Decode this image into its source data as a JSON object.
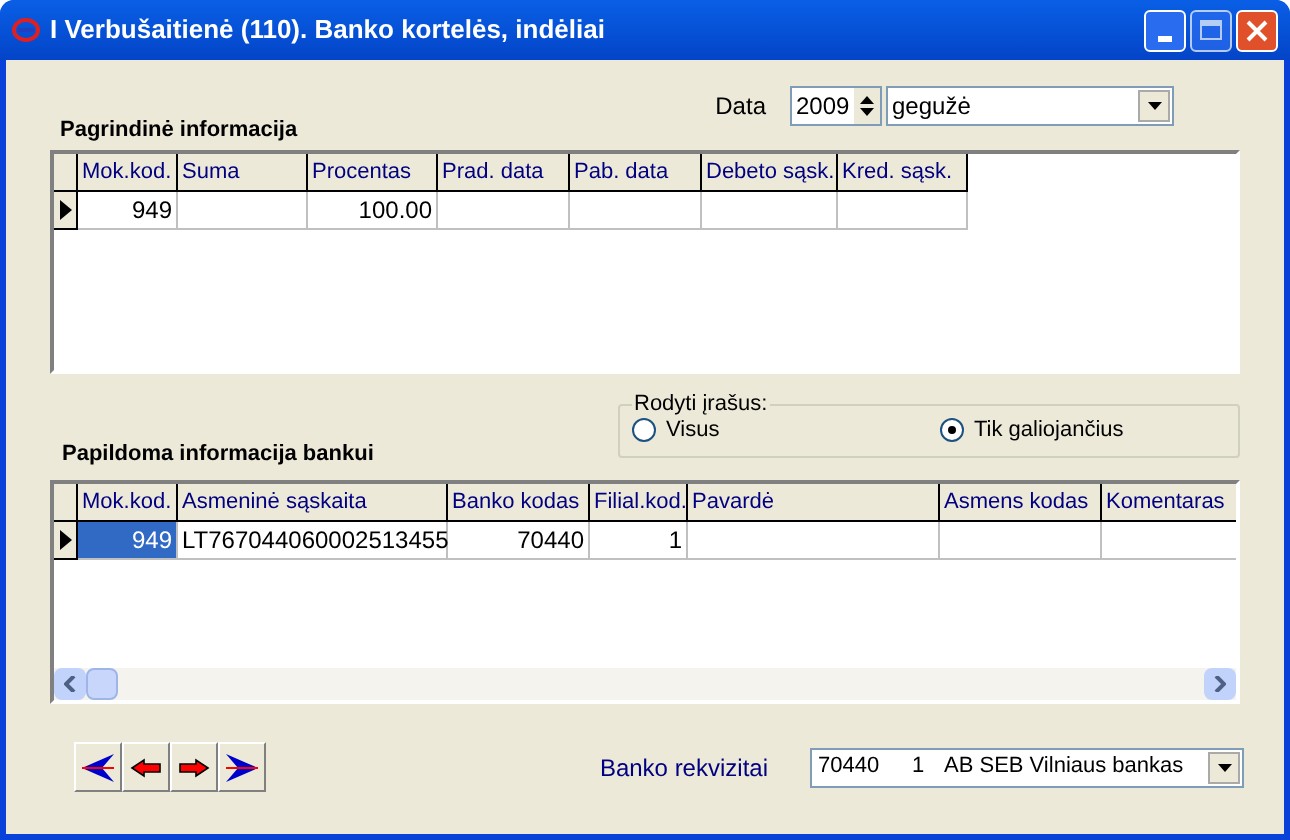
{
  "window": {
    "title": "I Verbušaitienė (110). Banko kortelės, indėliai"
  },
  "date": {
    "label": "Data",
    "year": "2009",
    "month": "gegužė"
  },
  "main_section": {
    "heading": "Pagrindinė informacija",
    "columns": [
      {
        "label": "Mok.kod.",
        "kind": "number"
      },
      {
        "label": "Suma",
        "kind": "number"
      },
      {
        "label": "Procentas",
        "kind": "number"
      },
      {
        "label": "Prad. data",
        "kind": "text"
      },
      {
        "label": "Pab. data",
        "kind": "text"
      },
      {
        "label": "Debeto sąsk.",
        "kind": "text"
      },
      {
        "label": "Kred. sąsk.",
        "kind": "text"
      }
    ],
    "rows": [
      {
        "current": true,
        "cells": [
          {
            "text": "949",
            "selected": false
          },
          {
            "text": "",
            "selected": false
          },
          {
            "text": "100.00",
            "selected": false
          },
          {
            "text": "",
            "selected": false
          },
          {
            "text": "",
            "selected": false
          },
          {
            "text": "",
            "selected": false
          },
          {
            "text": "",
            "selected": false
          }
        ]
      }
    ]
  },
  "filter": {
    "title": "Rodyti įrašus:",
    "options": [
      {
        "label": "Visus",
        "selected": false
      },
      {
        "label": "Tik galiojančius",
        "selected": true
      }
    ]
  },
  "bank_section": {
    "heading": "Papildoma informacija bankui",
    "columns": [
      {
        "label": "Mok.kod.",
        "kind": "number"
      },
      {
        "label": "Asmeninė sąskaita",
        "kind": "text"
      },
      {
        "label": "Banko kodas",
        "kind": "number"
      },
      {
        "label": "Filial.kod.",
        "kind": "number"
      },
      {
        "label": "Pavardė",
        "kind": "text"
      },
      {
        "label": "Asmens kodas",
        "kind": "text"
      },
      {
        "label": "Komentaras",
        "kind": "text"
      }
    ],
    "rows": [
      {
        "current": true,
        "cells": [
          {
            "text": "949",
            "selected": true
          },
          {
            "text": "LT767044060002513455",
            "selected": false
          },
          {
            "text": "70440",
            "selected": false
          },
          {
            "text": "1",
            "selected": false
          },
          {
            "text": "",
            "selected": false
          },
          {
            "text": "",
            "selected": false
          },
          {
            "text": "",
            "selected": false
          }
        ]
      }
    ]
  },
  "navigation": [
    {
      "kind": "first"
    },
    {
      "kind": "prev"
    },
    {
      "kind": "next"
    },
    {
      "kind": "last"
    }
  ],
  "bank_details": {
    "label": "Banko rekvizitai",
    "code": "70440",
    "branch": "1",
    "bank": "AB SEB Vilniaus bankas"
  }
}
